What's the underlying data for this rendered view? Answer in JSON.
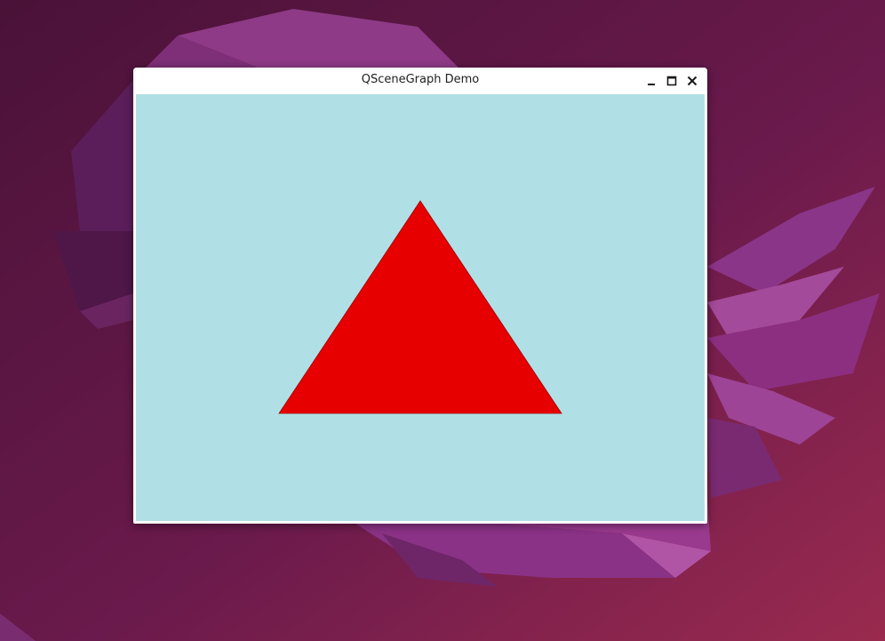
{
  "window": {
    "title": "QSceneGraph Demo"
  },
  "icons": {
    "minimize": "minimize-icon",
    "maximize": "maximize-icon",
    "close": "close-icon"
  },
  "scene": {
    "background_color": "#b0e0e6",
    "shape": "triangle",
    "fill_color": "#e60000"
  }
}
